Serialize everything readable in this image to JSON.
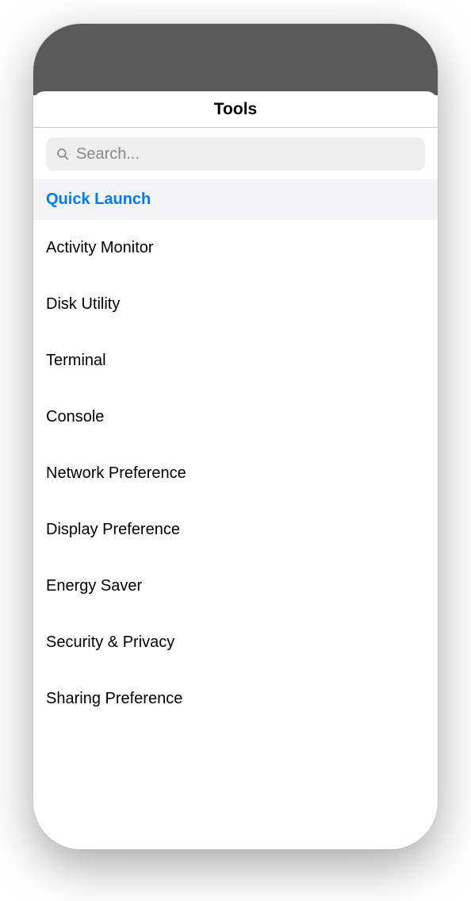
{
  "nav": {
    "title": "Tools"
  },
  "search": {
    "placeholder": "Search..."
  },
  "items": [
    {
      "label": "Quick Launch",
      "selected": true
    },
    {
      "label": "Activity Monitor",
      "selected": false
    },
    {
      "label": "Disk Utility",
      "selected": false
    },
    {
      "label": "Terminal",
      "selected": false
    },
    {
      "label": "Console",
      "selected": false
    },
    {
      "label": "Network Preference",
      "selected": false
    },
    {
      "label": "Display Preference",
      "selected": false
    },
    {
      "label": "Energy Saver",
      "selected": false
    },
    {
      "label": "Security & Privacy",
      "selected": false
    },
    {
      "label": "Sharing Preference",
      "selected": false
    }
  ]
}
